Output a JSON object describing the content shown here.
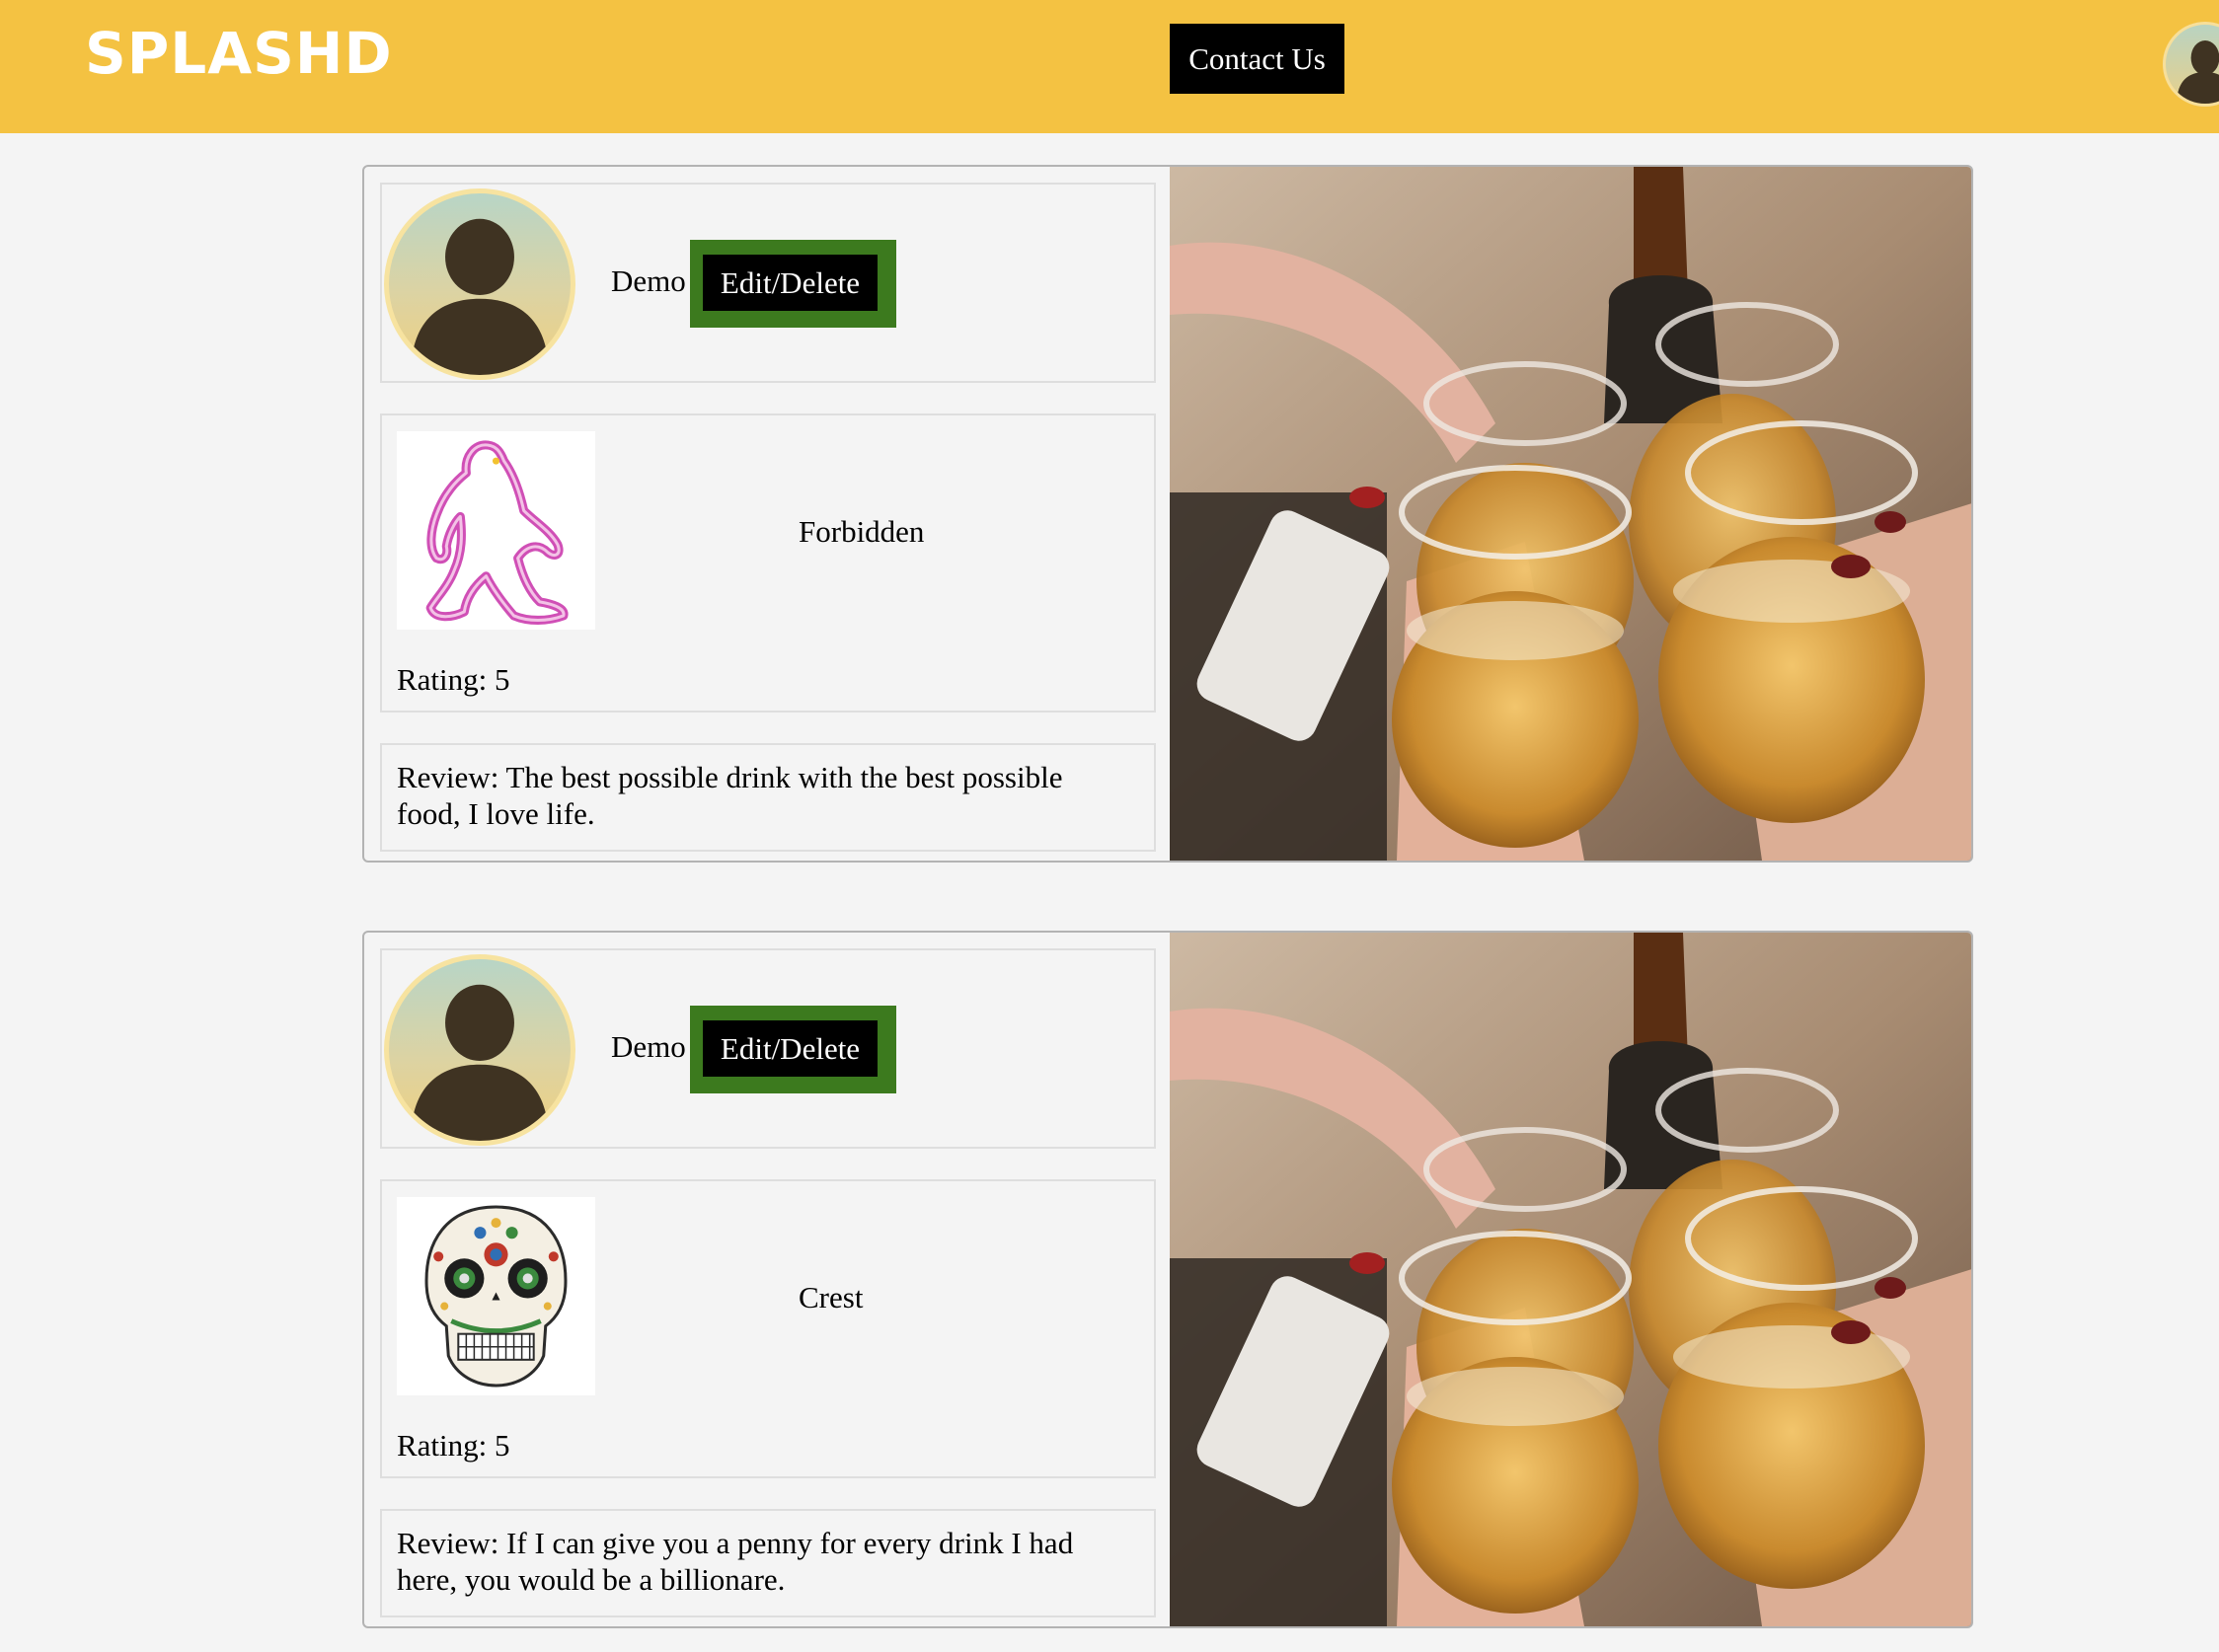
{
  "header": {
    "logo": "SPLASHD",
    "contact_label": "Contact Us"
  },
  "icons": {
    "profile": "user-avatar-icon",
    "bigfoot": "bigfoot-logo",
    "skull": "sugar-skull-logo"
  },
  "colors": {
    "header_bg": "#f4c242",
    "edit_frame": "#3c7a1e",
    "button_bg": "#000000"
  },
  "reviews": [
    {
      "username": "Demo",
      "edit_label": "Edit/Delete",
      "drink": "Forbidden",
      "rating": "Rating: 5",
      "review": "Review: The best possible drink with the best possible food, I love life."
    },
    {
      "username": "Demo",
      "edit_label": "Edit/Delete",
      "drink": "Crest",
      "rating": "Rating: 5",
      "review": "Review: If I can give you a penny for every drink I had here, you would be a billionare."
    }
  ]
}
